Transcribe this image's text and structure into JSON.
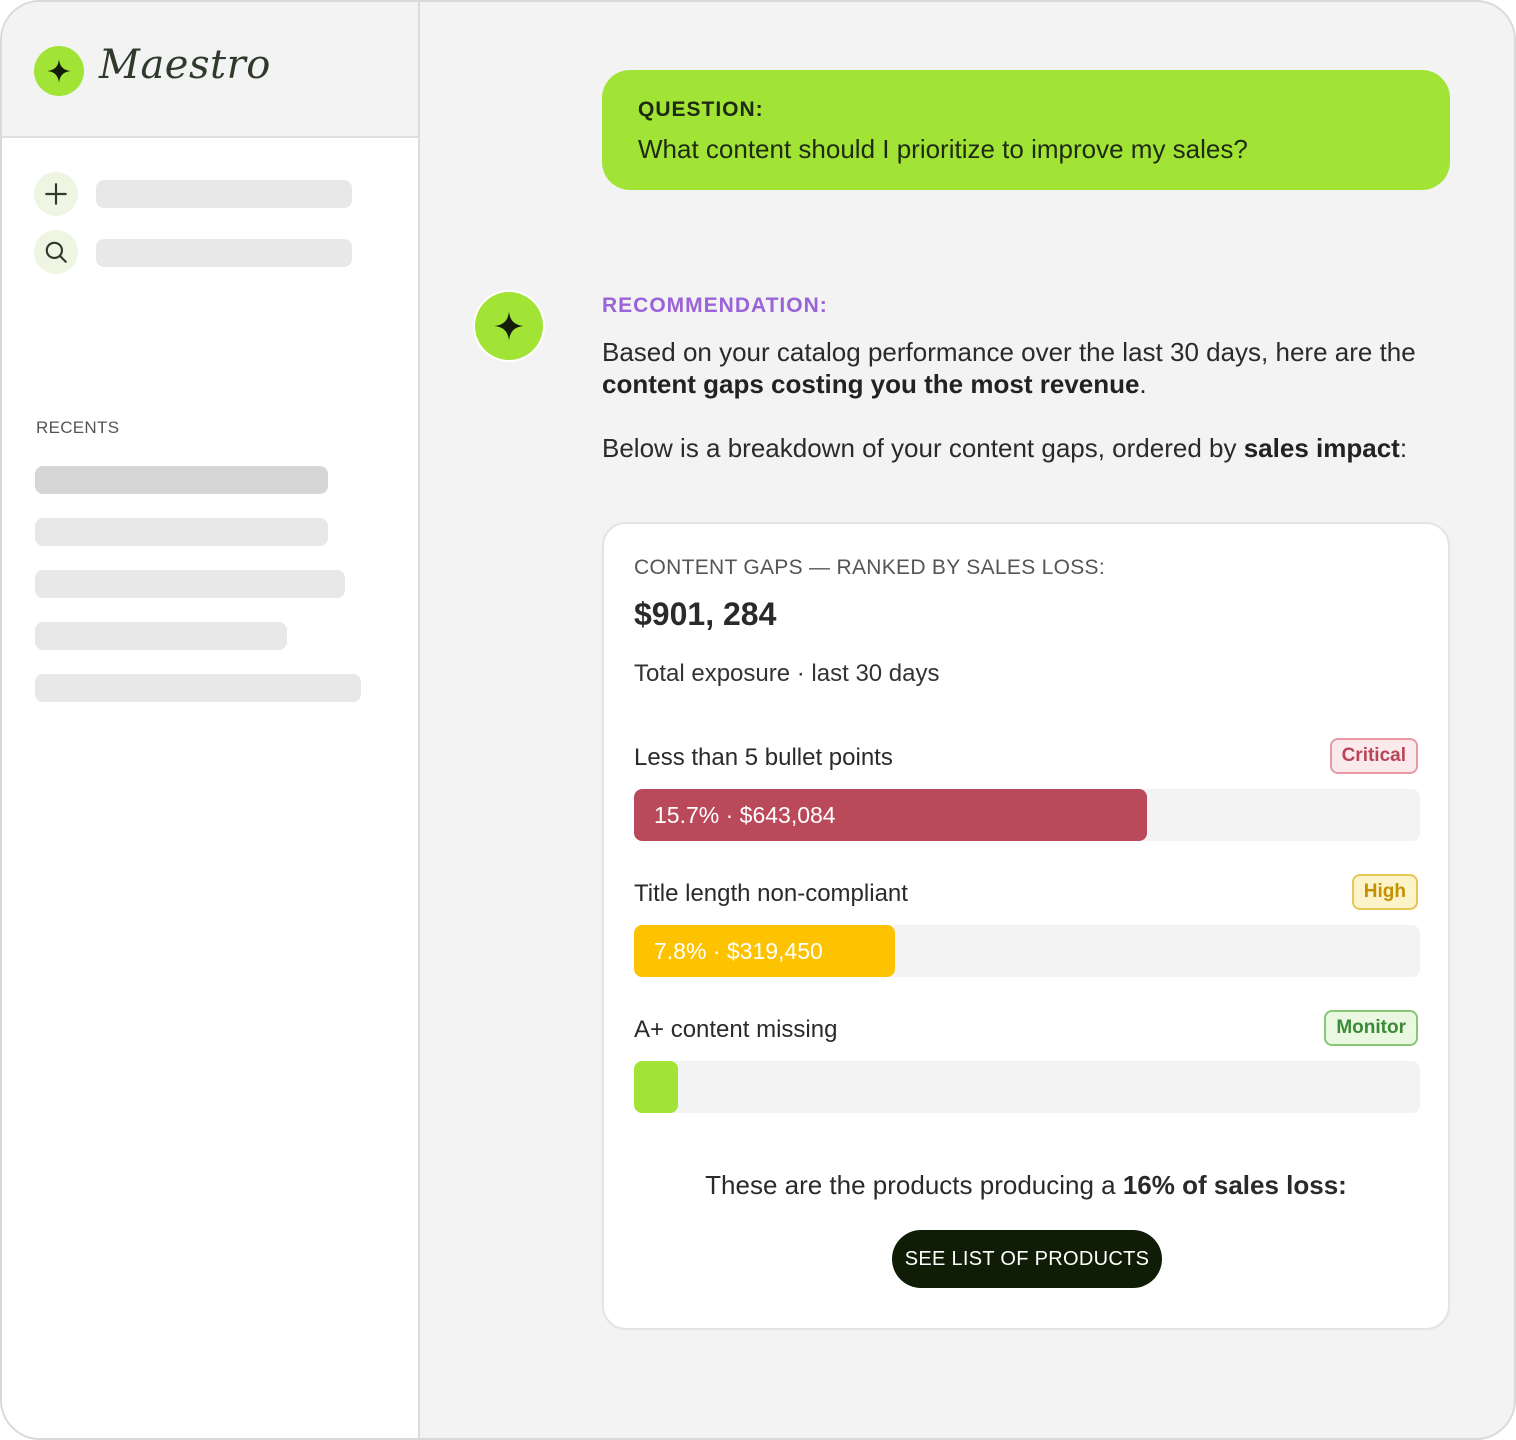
{
  "app": {
    "name": "Maestro",
    "brand_color": "#a1e435"
  },
  "sidebar": {
    "recents_label": "RECENTS",
    "actions": [
      {
        "icon": "plus-icon"
      },
      {
        "icon": "search-icon"
      }
    ]
  },
  "question": {
    "label": "QUESTION:",
    "text": "What content should I prioritize to improve my sales?"
  },
  "recommendation": {
    "label": "RECOMMENDATION:",
    "label_color": "#9b63d8",
    "para1_pre": "Based on your catalog performance over the last 30 days, here are the ",
    "para1_bold": "content gaps costing you the most revenue",
    "para1_post": ".",
    "para2_pre": "Below is a breakdown of your content gaps, ordered by ",
    "para2_bold": "sales impact",
    "para2_post": ":"
  },
  "card": {
    "label": "CONTENT GAPS — RANKED BY SALES LOSS:",
    "total": "$901, 284",
    "subtitle": "Total exposure · last 30 days",
    "gaps": [
      {
        "title": "Less than 5 bullet points",
        "badge": "Critical",
        "bar_label": "15.7% · $643,084",
        "fill_fraction": 0.653,
        "color": "#ba4a5a"
      },
      {
        "title": "Title length non-compliant",
        "badge": "High",
        "bar_label": "7.8% · $319,450",
        "fill_fraction": 0.332,
        "color": "#fdc300"
      },
      {
        "title": "A+ content missing",
        "badge": "Monitor",
        "bar_label": "",
        "fill_fraction": 0.056,
        "color": "#a1e435"
      }
    ],
    "summary_pre": "These are the products producing a ",
    "summary_bold": "16% of sales loss:",
    "cta_label": "SEE LIST OF PRODUCTS"
  }
}
